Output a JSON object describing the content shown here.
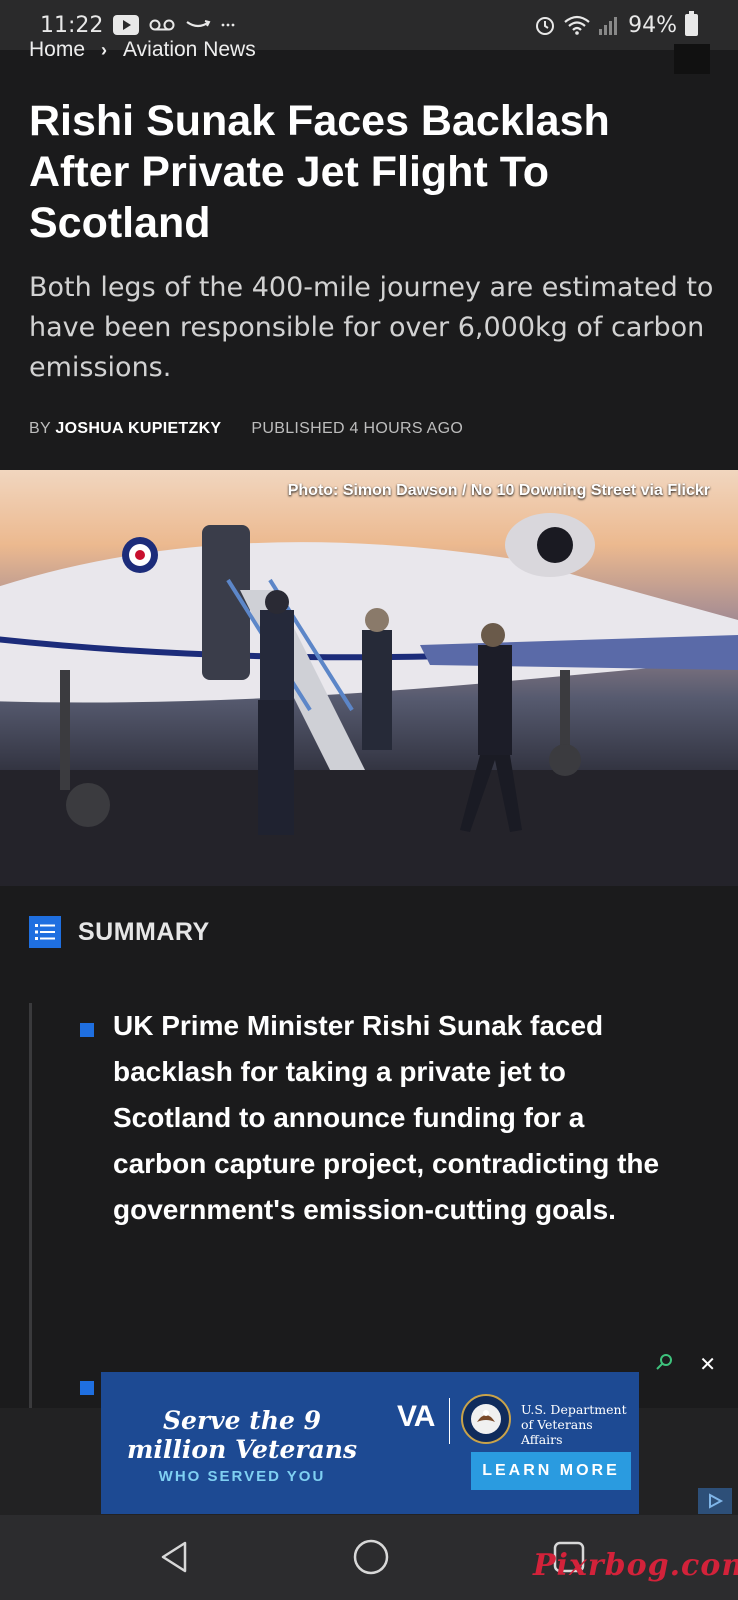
{
  "status_bar": {
    "time": "11:22",
    "battery": "94%",
    "icons": [
      "youtube-icon",
      "voicemail-icon",
      "amazon-icon",
      "more-notifications-icon",
      "alarm-icon",
      "wifi-icon",
      "signal-icon",
      "battery-icon"
    ]
  },
  "breadcrumb": {
    "home": "Home",
    "section": "Aviation News"
  },
  "article": {
    "headline": "Rishi Sunak Faces Backlash After Private Jet Flight To Scotland",
    "subheadline": "Both legs of the 400-mile journey are estimated to have been responsible for over 6,000kg of carbon emissions.",
    "by_prefix": "BY",
    "author": "JOSHUA KUPIETZKY",
    "published": "PUBLISHED 4 HOURS AGO",
    "photo_credit": "Photo: Simon Dawson / No 10 Downing Street via Flickr"
  },
  "summary": {
    "title": "SUMMARY",
    "items": [
      "UK Prime Minister Rishi Sunak faced backlash for taking a private jet to Scotland to announce funding for a carbon capture project, contradicting the government's emission-cutting goals."
    ]
  },
  "ad": {
    "headline": "Serve the 9 million Veterans",
    "subline": "WHO SERVED YOU",
    "logo": "VA",
    "department": "U.S. Department of Veterans Affairs",
    "cta": "LEARN MORE",
    "close_glyph": "✕"
  },
  "watermark": "Pixrbog.com",
  "colors": {
    "accent": "#1f6fe0",
    "background": "#1b1b1c",
    "ad_blue": "#1d4a93",
    "cta_blue": "#2a9be0"
  }
}
